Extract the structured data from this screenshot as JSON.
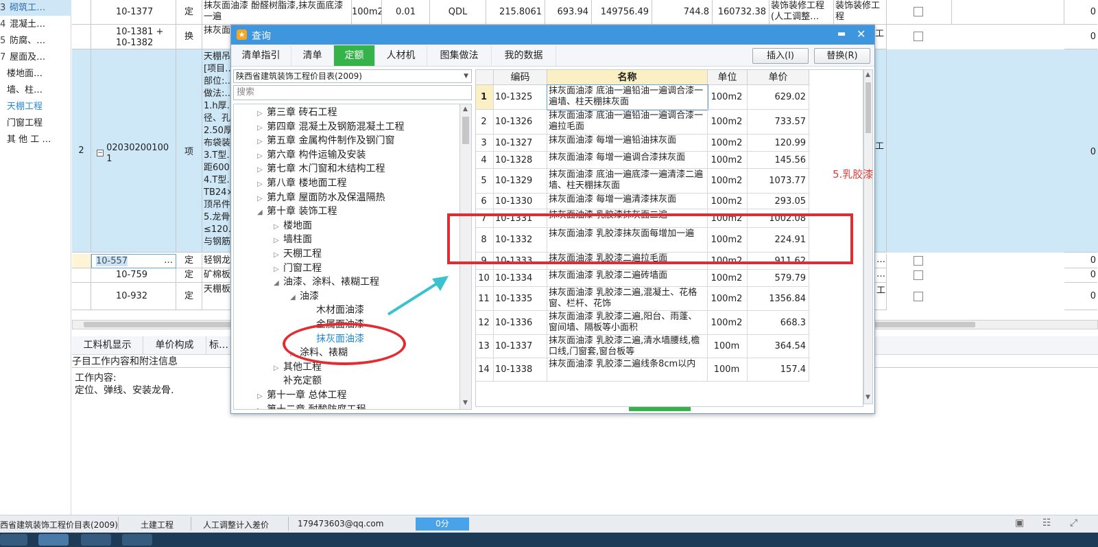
{
  "left_nav": {
    "items": [
      {
        "num": "3",
        "label": "砌筑工…"
      },
      {
        "num": "4",
        "label": "混凝土…"
      },
      {
        "num": "5",
        "label": "防腐、…"
      },
      {
        "num": "7",
        "label": "屋面及…"
      },
      {
        "num": "",
        "label": "楼地面…"
      },
      {
        "num": "",
        "label": "墙、柱…"
      },
      {
        "num": "",
        "label": "天棚工程"
      },
      {
        "num": "",
        "label": "门窗工程"
      },
      {
        "num": "",
        "label": "其 他 工 …"
      }
    ]
  },
  "main_grid": {
    "row_1377": {
      "code": "10-1377",
      "type": "定",
      "name": "抹灰面油漆 酚醛树脂漆,抹灰面底漆一遍",
      "unit": "100m2",
      "qty": "0.01",
      "code2": "QDL",
      "v1": "215.8061",
      "v2": "693.94",
      "v3": "149756.49",
      "v4": "744.8",
      "v5": "160732.38",
      "cat1": "装饰装修工程(人工调整…",
      "cat2": "装饰装修工程",
      "last": "0"
    },
    "row_1381": {
      "code": "10-1381 + 10-1382",
      "type": "换",
      "name": "抹灰面…底漆一…",
      "col_gong": "工",
      "last": "0"
    },
    "row_main": {
      "seq": "2",
      "code": "020302001001",
      "type": "项",
      "desc": [
        "天棚吊…",
        "[项目…",
        "部位:…",
        "做法:…",
        "1.h厚…",
        "径、孔…",
        "2.50厚…",
        "布袋装…",
        "3.T型…",
        "距600…",
        "4.T型…",
        "TB24×…",
        "顶吊件…",
        "5.龙骨…",
        "≤120…",
        "与钢筋…"
      ],
      "col_gong": "工",
      "last": "0"
    },
    "row_557": {
      "code": "10-557",
      "more": "…",
      "type": "定",
      "name": "轻钢龙…",
      "dots": "…",
      "last": "0"
    },
    "row_759": {
      "code": "10-759",
      "type": "定",
      "name": "矿棉板…",
      "dots": "…",
      "last": "0"
    },
    "row_932": {
      "code": "10-932",
      "type": "定",
      "name": "天棚板…玻璃板…",
      "col_gong": "工",
      "last": "0"
    }
  },
  "bottom_panel": {
    "tabs": [
      "工料机显示",
      "单价构成",
      "标…"
    ],
    "section_title": "子目工作内容和附注信息",
    "content_label": "工作内容:",
    "content": "定位、弹线、安装龙骨."
  },
  "dialog": {
    "title": "查询",
    "tabs": [
      "清单指引",
      "清单",
      "定额",
      "人材机",
      "图集做法",
      "我的数据"
    ],
    "active_tab": "定额",
    "insert_button": "插入(I)",
    "replace_button": "替换(R)",
    "library_select": "陕西省建筑装饰工程价目表(2009)",
    "search_placeholder": "搜索",
    "tree": [
      {
        "label": "第三章 砖石工程",
        "level": 0,
        "arrow": "closed"
      },
      {
        "label": "第四章 混凝土及钢筋混凝土工程",
        "level": 0,
        "arrow": "closed"
      },
      {
        "label": "第五章 金属构件制作及钢门窗",
        "level": 0,
        "arrow": "closed"
      },
      {
        "label": "第六章 构件运输及安装",
        "level": 0,
        "arrow": "closed"
      },
      {
        "label": "第七章 木门窗和木结构工程",
        "level": 0,
        "arrow": "closed"
      },
      {
        "label": "第八章 楼地面工程",
        "level": 0,
        "arrow": "closed"
      },
      {
        "label": "第九章 屋面防水及保温隔热",
        "level": 0,
        "arrow": "closed"
      },
      {
        "label": "第十章 装饰工程",
        "level": 0,
        "arrow": "open"
      },
      {
        "label": "楼地面",
        "level": 1,
        "arrow": "closed"
      },
      {
        "label": "墙柱面",
        "level": 1,
        "arrow": "closed"
      },
      {
        "label": "天棚工程",
        "level": 1,
        "arrow": "closed"
      },
      {
        "label": "门窗工程",
        "level": 1,
        "arrow": "closed"
      },
      {
        "label": "油漆、涂料、裱糊工程",
        "level": 1,
        "arrow": "open"
      },
      {
        "label": "油漆",
        "level": 2,
        "arrow": "open"
      },
      {
        "label": "木材面油漆",
        "level": 3,
        "arrow": "none"
      },
      {
        "label": "金属面油漆",
        "level": 3,
        "arrow": "none"
      },
      {
        "label": "抹灰面油漆",
        "level": 3,
        "arrow": "none",
        "selected": true
      },
      {
        "label": "涂料、裱糊",
        "level": 2,
        "arrow": "closed"
      },
      {
        "label": "其他工程",
        "level": 1,
        "arrow": "closed"
      },
      {
        "label": "补充定额",
        "level": 1,
        "arrow": "none"
      },
      {
        "label": "第十一章 总体工程",
        "level": 0,
        "arrow": "closed"
      },
      {
        "label": "第十二章 耐酸防腐工程",
        "level": 0,
        "arrow": "closed"
      }
    ],
    "table": {
      "headers": {
        "code": "编码",
        "name": "名称",
        "unit": "单位",
        "price": "单价"
      },
      "rows": [
        {
          "n": "1",
          "code": "10-1325",
          "name": "抹灰面油漆 底油一遍铅油一遍调合漆一遍墙、柱天棚抹灰面",
          "unit": "100m2",
          "price": "629.02"
        },
        {
          "n": "2",
          "code": "10-1326",
          "name": "抹灰面油漆 底油一遍铅油一遍调合漆一遍拉毛面",
          "unit": "100m2",
          "price": "733.57"
        },
        {
          "n": "3",
          "code": "10-1327",
          "name": "抹灰面油漆 每增一遍铅油抹灰面",
          "unit": "100m2",
          "price": "120.99"
        },
        {
          "n": "4",
          "code": "10-1328",
          "name": "抹灰面油漆 每增一遍调合漆抹灰面",
          "unit": "100m2",
          "price": "145.56"
        },
        {
          "n": "5",
          "code": "10-1329",
          "name": "抹灰面油漆 底油一遍底漆一遍清漆二遍墙、柱天棚抹灰面",
          "unit": "100m2",
          "price": "1073.77"
        },
        {
          "n": "6",
          "code": "10-1330",
          "name": "抹灰面油漆 每增一遍清漆抹灰面",
          "unit": "100m2",
          "price": "293.05"
        },
        {
          "n": "7",
          "code": "10-1331",
          "name": "抹灰面油漆 乳胶漆抹灰面二遍",
          "unit": "100m2",
          "price": "1002.08"
        },
        {
          "n": "8",
          "code": "10-1332",
          "name": "抹灰面油漆 乳胶漆抹灰面每增加一遍",
          "unit": "100m2",
          "price": "224.91"
        },
        {
          "n": "9",
          "code": "10-1333",
          "name": "抹灰面油漆 乳胶漆二遍拉毛面",
          "unit": "100m2",
          "price": "911.62"
        },
        {
          "n": "10",
          "code": "10-1334",
          "name": "抹灰面油漆 乳胶漆二遍砖墙面",
          "unit": "100m2",
          "price": "579.79"
        },
        {
          "n": "11",
          "code": "10-1335",
          "name": "抹灰面油漆 乳胶漆二遍,混凝土、花格窗、栏杆、花饰",
          "unit": "100m2",
          "price": "1356.84"
        },
        {
          "n": "12",
          "code": "10-1336",
          "name": "抹灰面油漆 乳胶漆二遍,阳台、雨蓬、窗间墙、隔板等小面积",
          "unit": "100m2",
          "price": "668.3"
        },
        {
          "n": "13",
          "code": "10-1337",
          "name": "抹灰面油漆 乳胶漆二遍,清水墙腰线,檐口线,门窗套,窗台板等",
          "unit": "100m",
          "price": "364.54"
        },
        {
          "n": "14",
          "code": "10-1338",
          "name": "抹灰面油漆 乳胶漆二遍线条8cm以内",
          "unit": "100m",
          "price": "157.4"
        }
      ]
    }
  },
  "annotation": {
    "text": "5.乳胶漆",
    "color": "#e23b3b"
  },
  "statusbar": {
    "library": "西省建筑装饰工程价目表(2009)",
    "project": "土建工程",
    "labor": "人工调整计入差价",
    "email": "179473603@qq.com",
    "score": "0分"
  },
  "colors": {
    "accent": "#3e97de",
    "active_tab": "#36b24a",
    "selected_row": "#cfe8f7",
    "highlight_red": "#e32b32"
  }
}
